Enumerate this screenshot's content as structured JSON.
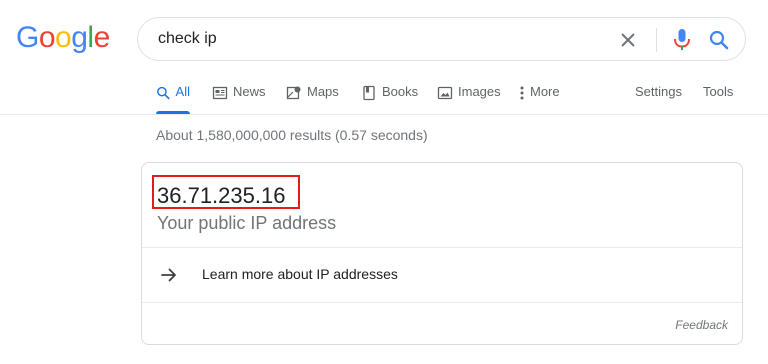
{
  "logo": {
    "letters": [
      "G",
      "o",
      "o",
      "g",
      "l",
      "e"
    ]
  },
  "search": {
    "query": "check ip"
  },
  "nav": {
    "tabs": [
      {
        "label": "All",
        "icon": "search-icon"
      },
      {
        "label": "News",
        "icon": "news-icon"
      },
      {
        "label": "Maps",
        "icon": "maps-icon"
      },
      {
        "label": "Books",
        "icon": "books-icon"
      },
      {
        "label": "Images",
        "icon": "images-icon"
      },
      {
        "label": "More",
        "icon": "more-vert-icon"
      }
    ],
    "settings_label": "Settings",
    "tools_label": "Tools",
    "active_tab": "All"
  },
  "results_count": "About 1,580,000,000 results (0.57 seconds)",
  "card": {
    "ip": "36.71.235.16",
    "ip_label": "Your public IP address",
    "learn_more": "Learn more about IP addresses",
    "feedback": "Feedback"
  },
  "colors": {
    "blue": "#4285f4",
    "red": "#ea4335",
    "yellow": "#fbbc05",
    "green": "#34a853",
    "active_tab": "#1a73e8",
    "highlight_border": "#e21c1c"
  }
}
